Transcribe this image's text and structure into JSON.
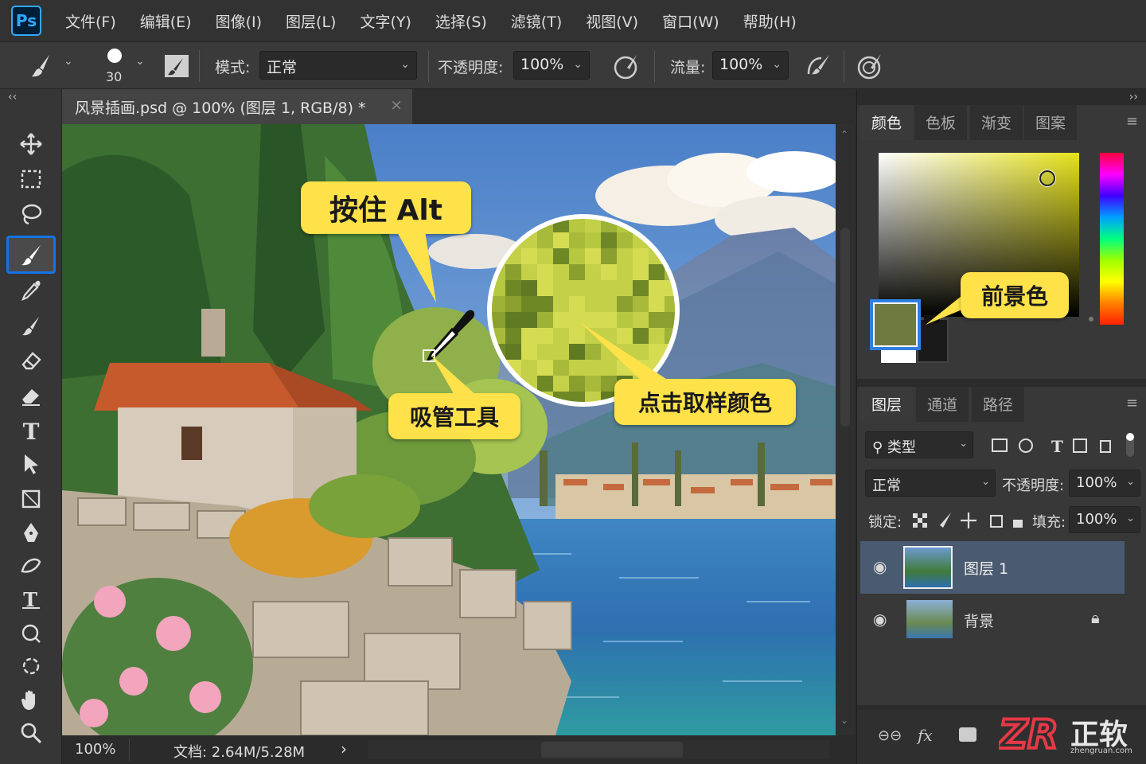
{
  "app": {
    "logo": "Ps",
    "brand_color": "#31a8ff"
  },
  "menu": [
    "文件(F)",
    "编辑(E)",
    "图像(I)",
    "图层(L)",
    "文字(Y)",
    "选择(S)",
    "滤镜(T)",
    "视图(V)",
    "窗口(W)",
    "帮助(H)"
  ],
  "options": {
    "brush_size": "30",
    "mode_label": "模式:",
    "mode_value": "正常",
    "opacity_label": "不透明度:",
    "opacity_value": "100%",
    "flow_label": "流量:",
    "flow_value": "100%"
  },
  "document": {
    "tab_title": "风景插画.psd @ 100% (图层 1, RGB/8) *",
    "close": "×",
    "zoom": "100%",
    "doc_info": "文档: 2.64M/5.28M",
    "status_arrow": "›"
  },
  "callouts": {
    "hold_alt": "按住 Alt",
    "eyedropper": "吸管工具",
    "click_sample": "点击取样颜色",
    "foreground": "前景色"
  },
  "color_panel": {
    "tabs": [
      "颜色",
      "色板",
      "渐变",
      "图案"
    ],
    "foreground_color": "#6e7a3e",
    "background_color": "#1a1a1a",
    "hue_color": "#e6e21c"
  },
  "layers_panel": {
    "tabs": [
      "图层",
      "通道",
      "路径"
    ],
    "filter_label": "类型",
    "blend_mode": "正常",
    "opacity_label": "不透明度:",
    "opacity_value": "100%",
    "lock_label": "锁定:",
    "fill_label": "填充:",
    "fill_value": "100%",
    "layers": [
      {
        "name": "图层 1",
        "selected": true
      },
      {
        "name": "背景",
        "locked": true
      }
    ]
  },
  "watermark": {
    "brand": "正软",
    "domain": "zhengruan.com"
  }
}
